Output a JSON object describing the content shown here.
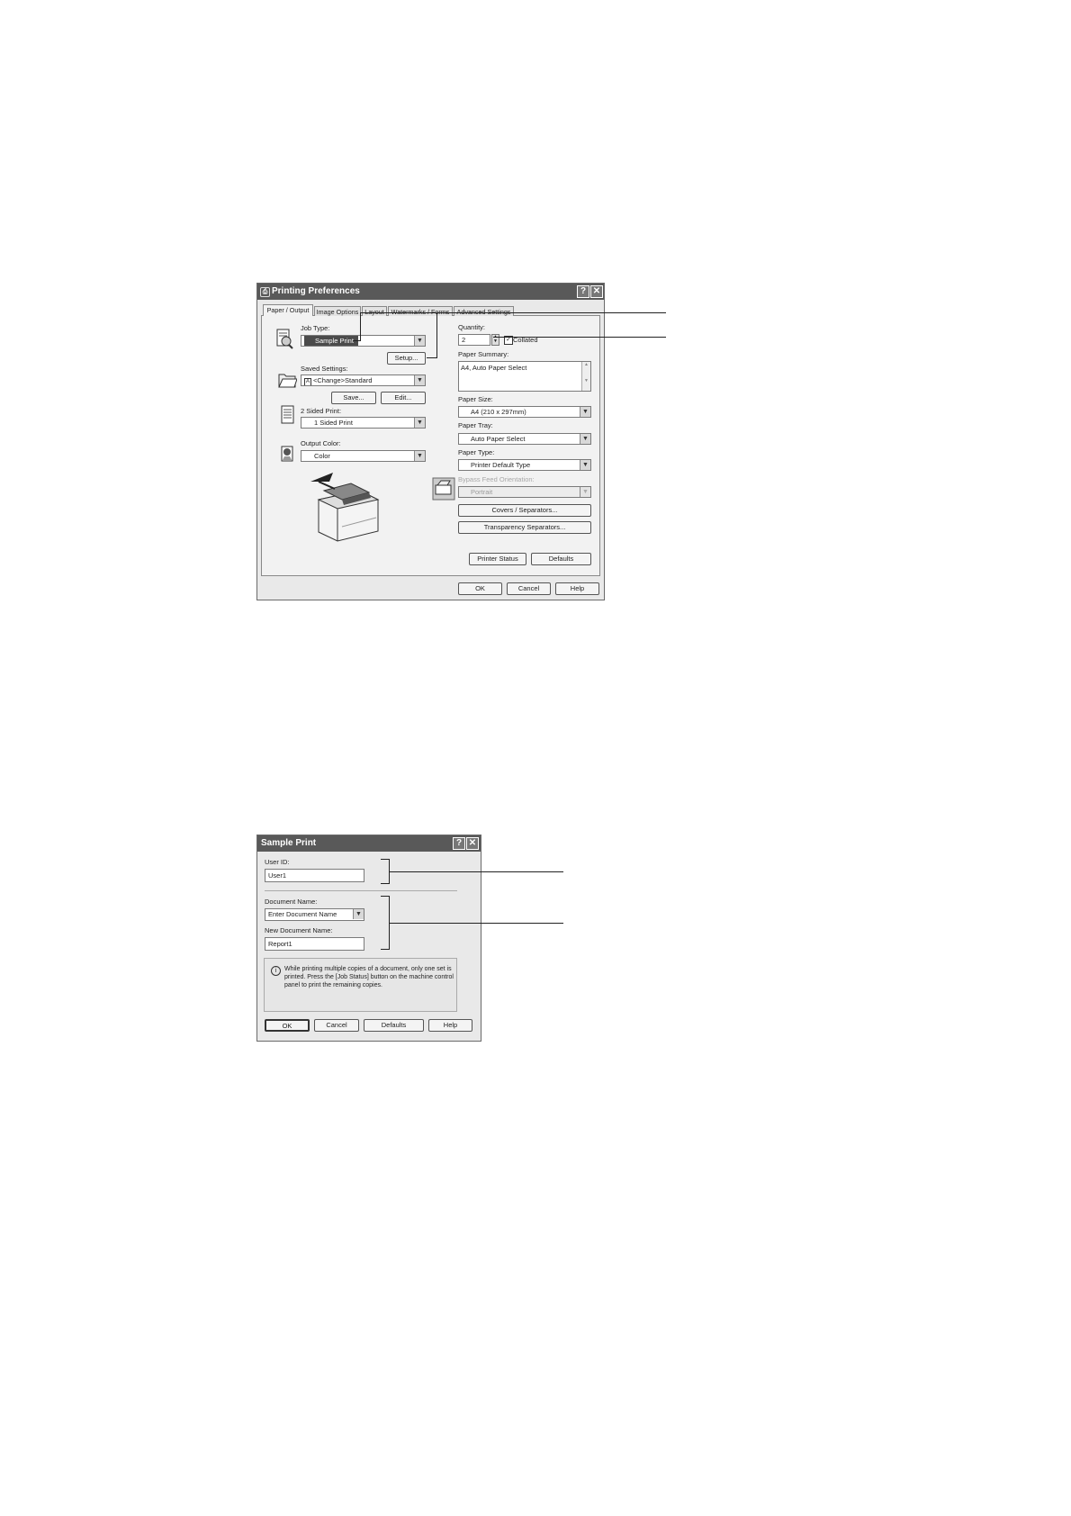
{
  "printing_prefs": {
    "title": "Printing Preferences",
    "help_btn": "?",
    "close_btn": "✕",
    "tabs": [
      "Paper / Output",
      "Image Options",
      "Layout",
      "Watermarks / Forms",
      "Advanced Settings"
    ],
    "job_type": {
      "label": "Job Type:",
      "value": "Sample Print",
      "setup_btn": "Setup..."
    },
    "saved_settings": {
      "label": "Saved Settings:",
      "value": "<Change>Standard",
      "save_btn": "Save...",
      "edit_btn": "Edit..."
    },
    "two_sided": {
      "label": "2 Sided Print:",
      "value": "1 Sided Print"
    },
    "output_color": {
      "label": "Output Color:",
      "value": "Color"
    },
    "quantity": {
      "label": "Quantity:",
      "value": "2",
      "collated_label": "Collated",
      "collated_checked": true
    },
    "paper_summary": {
      "label": "Paper Summary:",
      "value": "A4, Auto Paper Select"
    },
    "paper_size": {
      "label": "Paper Size:",
      "value": "A4 (210 x 297mm)"
    },
    "paper_tray": {
      "label": "Paper Tray:",
      "value": "Auto Paper Select"
    },
    "paper_type": {
      "label": "Paper Type:",
      "value": "Printer Default Type"
    },
    "bypass": {
      "label": "Bypass Feed Orientation:",
      "value": "Portrait"
    },
    "covers_btn": "Covers / Separators...",
    "transparency_btn": "Transparency Separators...",
    "printer_status_btn": "Printer Status",
    "defaults_btn": "Defaults",
    "ok_btn": "OK",
    "cancel_btn": "Cancel",
    "help_bottom_btn": "Help"
  },
  "sample_print": {
    "title": "Sample Print",
    "help_btn": "?",
    "close_btn": "✕",
    "user_id": {
      "label": "User ID:",
      "value": "User1"
    },
    "document_name": {
      "label": "Document Name:",
      "value": "Enter Document Name"
    },
    "new_document_name": {
      "label": "New Document Name:",
      "value": "Report1"
    },
    "info_text": "While printing multiple copies of a document, only one set is printed.  Press the [Job Status] button on the machine control panel to print the remaining copies.",
    "ok_btn": "OK",
    "cancel_btn": "Cancel",
    "defaults_btn": "Defaults",
    "help_bottom_btn": "Help"
  },
  "colors": {
    "titlebar": "#595959",
    "dialog": "#e9e9e9",
    "selection": "#4b4b4b"
  },
  "icons": [
    "printer-icon",
    "job-type-icon",
    "folder-icon",
    "two-sided-icon",
    "color-icon",
    "bypass-tray-icon",
    "info-icon"
  ]
}
